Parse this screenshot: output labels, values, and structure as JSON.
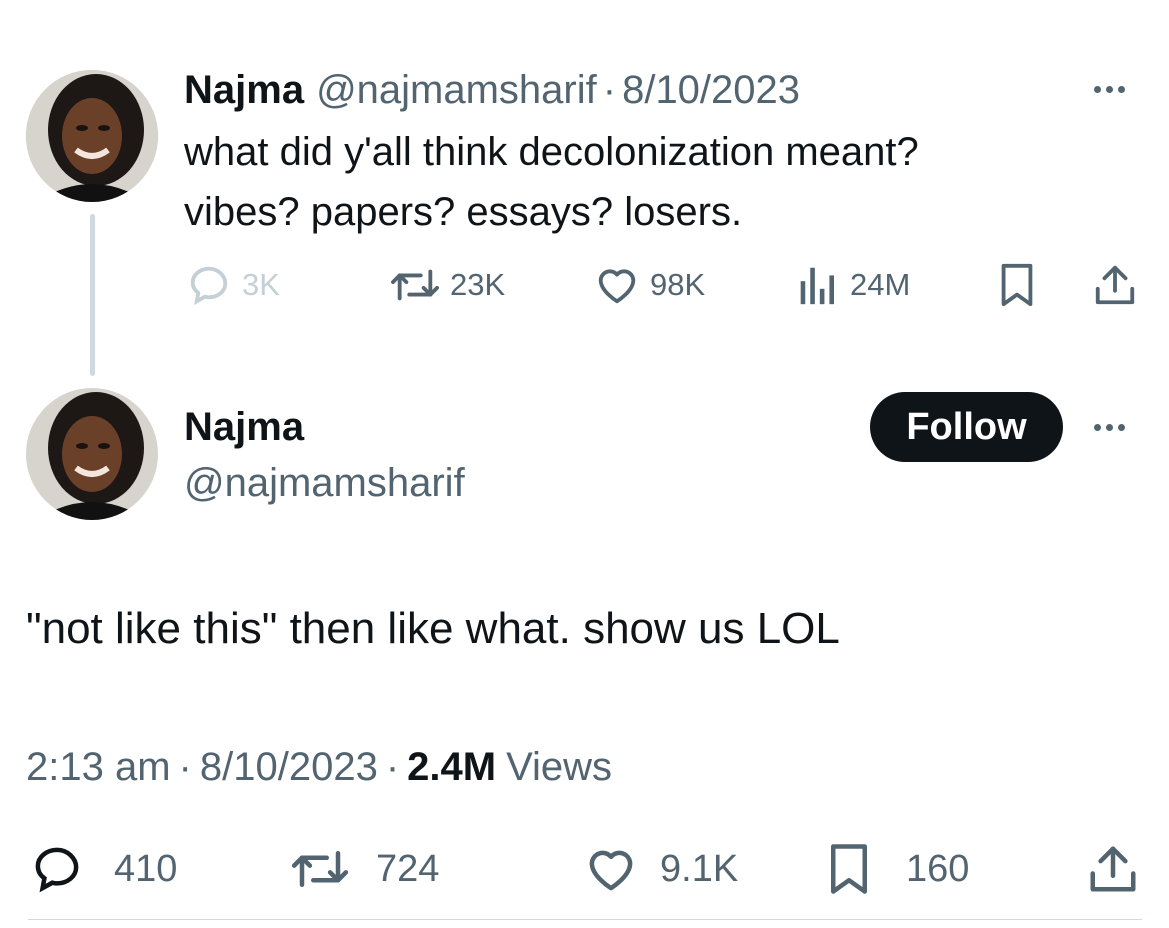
{
  "parent_tweet": {
    "display_name": "Najma",
    "handle": "@najmamsharif",
    "date": "8/10/2023",
    "separator": "·",
    "text_line1": "what did y'all think decolonization meant?",
    "text_line2": "vibes? papers? essays? losers.",
    "replies": "3K",
    "retweets": "23K",
    "likes": "98K",
    "views": "24M"
  },
  "main_tweet": {
    "display_name": "Najma",
    "handle": "@najmamsharif",
    "follow_label": "Follow",
    "text": "\"not like this\" then like what. show us LOL",
    "time": "2:13 am",
    "date": "8/10/2023",
    "separator": "·",
    "views_count": "2.4M",
    "views_label": "Views",
    "replies": "410",
    "retweets": "724",
    "likes": "9.1K",
    "bookmarks": "160"
  },
  "icons": {
    "reply": "reply-icon",
    "retweet": "retweet-icon",
    "like": "heart-icon",
    "views": "views-icon",
    "bookmark": "bookmark-icon",
    "share": "share-icon",
    "more": "more-icon"
  },
  "colors": {
    "text": "#0f1419",
    "muted": "#536471",
    "faded": "#c4cfd6",
    "thread_line": "#cfd9de",
    "follow_bg": "#0f1419"
  }
}
